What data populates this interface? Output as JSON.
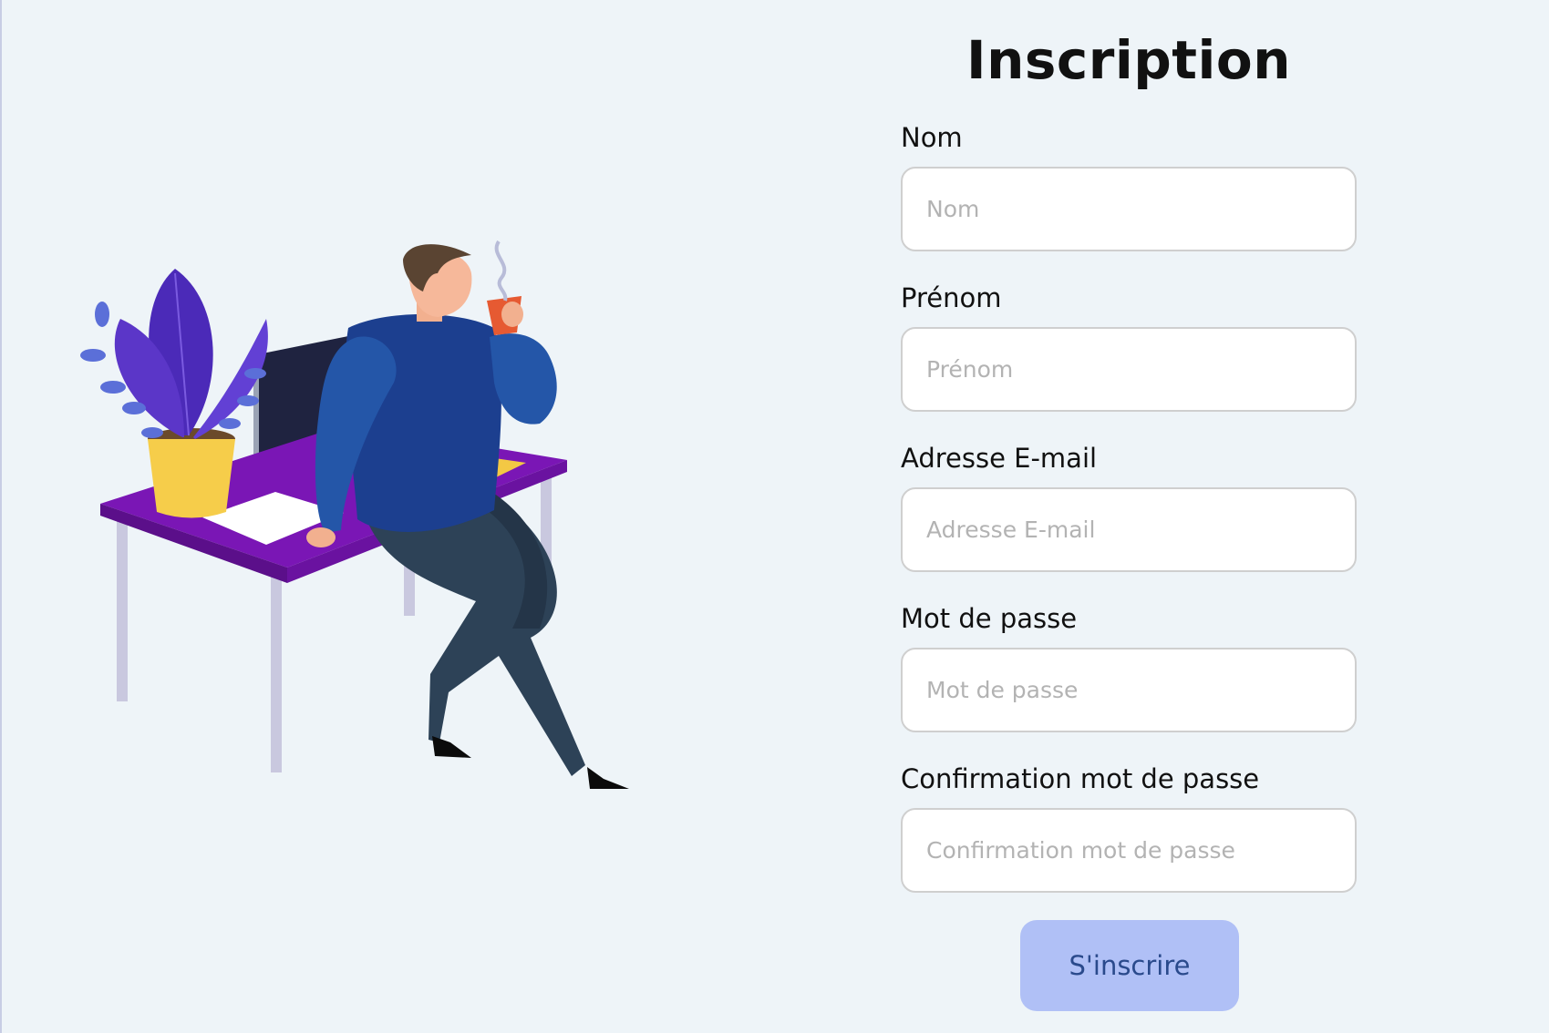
{
  "form": {
    "title": "Inscription",
    "fields": [
      {
        "label": "Nom",
        "placeholder": "Nom",
        "value": ""
      },
      {
        "label": "Prénom",
        "placeholder": "Prénom",
        "value": ""
      },
      {
        "label": "Adresse E-mail",
        "placeholder": "Adresse E-mail",
        "value": ""
      },
      {
        "label": "Mot de passe",
        "placeholder": "Mot de passe",
        "value": ""
      },
      {
        "label": "Confirmation mot de passe",
        "placeholder": "Confirmation mot de passe",
        "value": ""
      }
    ],
    "submit_label": "S'inscrire"
  },
  "colors": {
    "page_background": "#eef4f8",
    "button_background": "#b0c0f6",
    "button_text": "#2a4a8c",
    "input_border": "#cfcfcf"
  }
}
